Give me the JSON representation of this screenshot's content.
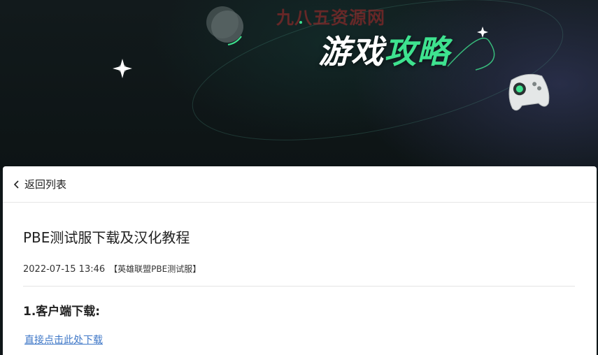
{
  "banner": {
    "watermark": "九八五资源网",
    "title_plain": "游戏",
    "title_accent": "攻略"
  },
  "nav": {
    "back_label": "返回列表"
  },
  "article": {
    "title": "PBE测试服下载及汉化教程",
    "date": "2022-07-15 13:46",
    "tag": "【英雄联盟PBE测试服】",
    "section_heading": "1.客户端下载:",
    "download_link": "直接点击此处下载"
  },
  "colors": {
    "accent_green": "#3ee28f",
    "link_blue": "#3e77c7",
    "banner_bg": "#0f1618"
  },
  "icons": [
    "planet-icon",
    "sparkle-icon",
    "gamepad-icon",
    "chevron-left-icon"
  ]
}
